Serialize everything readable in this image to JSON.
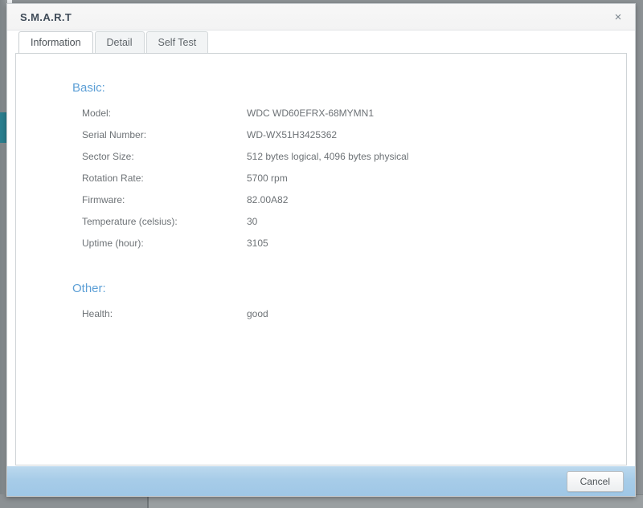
{
  "dialog": {
    "title": "S.M.A.R.T",
    "close_icon": "close-icon",
    "close_glyph": "×"
  },
  "tabs": [
    {
      "label": "Information",
      "active": true
    },
    {
      "label": "Detail",
      "active": false
    },
    {
      "label": "Self Test",
      "active": false
    }
  ],
  "sections": [
    {
      "title": "Basic:",
      "rows": [
        {
          "label": "Model:",
          "value": "WDC WD60EFRX-68MYMN1"
        },
        {
          "label": "Serial Number:",
          "value": "WD-WX51H3425362"
        },
        {
          "label": "Sector Size:",
          "value": "512 bytes logical, 4096 bytes physical"
        },
        {
          "label": "Rotation Rate:",
          "value": "5700 rpm"
        },
        {
          "label": "Firmware:",
          "value": "82.00A82"
        },
        {
          "label": "Temperature (celsius):",
          "value": "30"
        },
        {
          "label": "Uptime (hour):",
          "value": "3105"
        }
      ]
    },
    {
      "title": "Other:",
      "rows": [
        {
          "label": "Health:",
          "value": "good"
        }
      ]
    }
  ],
  "footer": {
    "cancel_label": "Cancel"
  },
  "colors": {
    "section_title": "#5c9fd6",
    "footer_background": "#a7cce8",
    "sidebar_active": "#2a7e8e",
    "desktop_background": "#8c9194"
  }
}
